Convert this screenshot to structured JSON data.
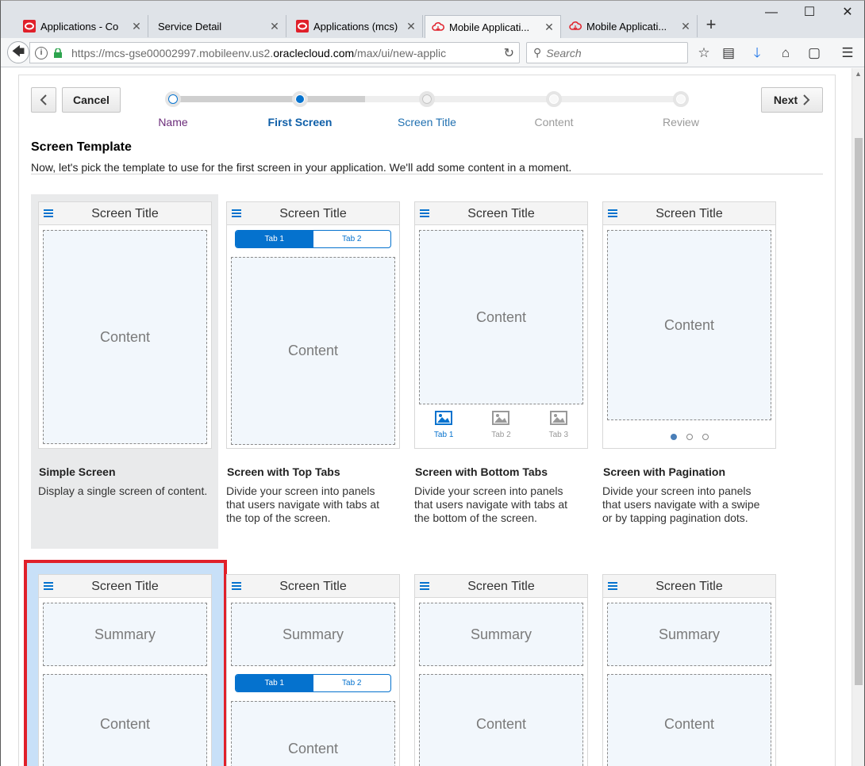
{
  "browser": {
    "tabs": [
      {
        "title": "Applications - Co",
        "icon": "oracle-logo-icon"
      },
      {
        "title": "Service Detail",
        "icon": ""
      },
      {
        "title": "Applications (mcs)",
        "icon": "oracle-logo-icon"
      },
      {
        "title": "Mobile Applicati...",
        "icon": "cloud-icon",
        "active": true
      },
      {
        "title": "Mobile Applicati...",
        "icon": "cloud-icon"
      }
    ],
    "url_prefix": "https://mcs-gse00002997.mobileenv.us2.",
    "url_domain": "oraclecloud.com",
    "url_suffix": "/max/ui/new-applic",
    "search_placeholder": "Search"
  },
  "wizard": {
    "cancel_label": "Cancel",
    "next_label": "Next",
    "steps": [
      {
        "label": "Name",
        "state": "visited"
      },
      {
        "label": "First Screen",
        "state": "current"
      },
      {
        "label": "Screen Title",
        "state": "next"
      },
      {
        "label": "Content",
        "state": "disabled"
      },
      {
        "label": "Review",
        "state": "disabled"
      }
    ]
  },
  "section": {
    "title": "Screen Template",
    "description": "Now, let's pick the template to use for the first screen in your application. We'll add some content in a moment."
  },
  "templates": [
    {
      "name": "Simple Screen",
      "description": "Display a single screen of content.",
      "screen_title": "Screen Title",
      "content": "Content"
    },
    {
      "name": "Screen with Top Tabs",
      "description": "Divide your screen into panels that users navigate with tabs at the top of the screen.",
      "screen_title": "Screen Title",
      "content": "Content",
      "tabs": [
        "Tab 1",
        "Tab 2"
      ]
    },
    {
      "name": "Screen with Bottom Tabs",
      "description": "Divide your screen into panels that users navigate with tabs at the bottom of the screen.",
      "screen_title": "Screen Title",
      "content": "Content",
      "tabs": [
        "Tab 1",
        "Tab 2",
        "Tab 3"
      ]
    },
    {
      "name": "Screen with Pagination",
      "description": "Divide your screen into panels that users navigate with a swipe or by tapping pagination dots.",
      "screen_title": "Screen Title",
      "content": "Content"
    }
  ],
  "templates_row2": [
    {
      "screen_title": "Screen Title",
      "summary": "Summary",
      "content": "Content"
    },
    {
      "screen_title": "Screen Title",
      "summary": "Summary",
      "content": "Content",
      "tabs": [
        "Tab 1",
        "Tab 2"
      ]
    },
    {
      "screen_title": "Screen Title",
      "summary": "Summary",
      "content": "Content"
    },
    {
      "screen_title": "Screen Title",
      "summary": "Summary",
      "content": "Content"
    }
  ],
  "colors": {
    "accent": "#0572ce",
    "selection_red": "#e0202a",
    "visited_step": "#6b2c7a"
  }
}
